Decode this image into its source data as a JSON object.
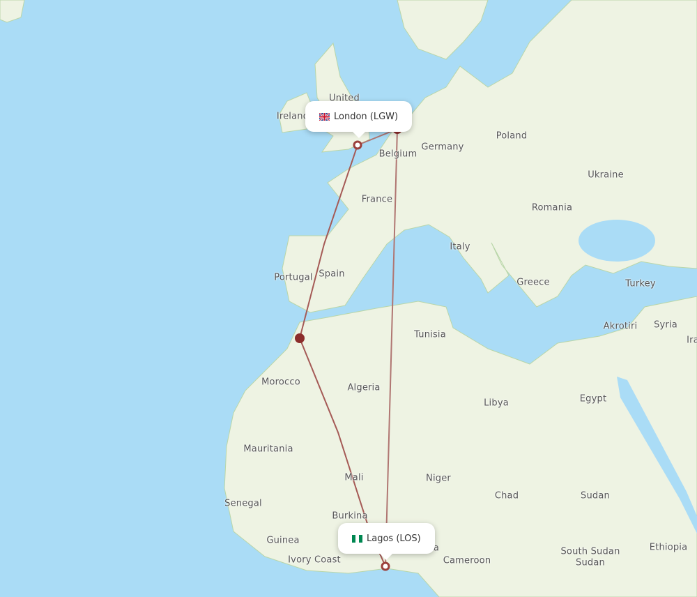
{
  "colors": {
    "sea": "#aadcf6",
    "land": "#eef3e3",
    "route": "#a55a56",
    "hub": "#8b2c2b"
  },
  "airports": {
    "origin": {
      "label": "London (LGW)",
      "flag": "uk-flag-icon"
    },
    "destination": {
      "label": "Lagos (LOS)",
      "flag": "nigeria-flag-icon"
    }
  },
  "routes": [
    {
      "via": "Amsterdam hub",
      "stops": [
        "LGW",
        "AMS",
        "LOS"
      ]
    },
    {
      "via": "Casablanca hub",
      "stops": [
        "LGW",
        "CMN",
        "LOS"
      ]
    }
  ],
  "country_labels": [
    "United",
    "Ireland",
    "Belgium",
    "Germany",
    "Poland",
    "Ukraine",
    "France",
    "Romania",
    "Italy",
    "Portugal",
    "Spain",
    "Greece",
    "Turkey",
    "Akrotiri",
    "Syria",
    "Ira",
    "Tunisia",
    "Morocco",
    "Algeria",
    "Libya",
    "Egypt",
    "Mauritania",
    "Mali",
    "Niger",
    "Chad",
    "Sudan",
    "Senegal",
    "Burkina",
    "Guinea",
    "Ivory Coast",
    "a",
    "Cameroon",
    "South Sudan",
    "Sudan",
    "Ethiopia"
  ]
}
